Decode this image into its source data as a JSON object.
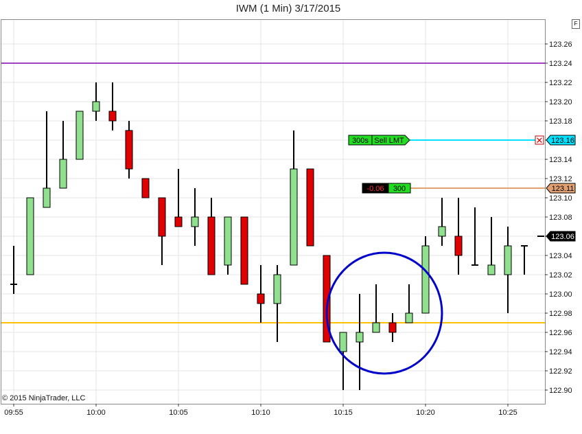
{
  "window": {
    "title": "IWM (1 Min)  3/17/2015",
    "corner_button": "F"
  },
  "copyright": "© 2015 NinjaTrader, LLC",
  "colors": {
    "up_candle": "#90e090",
    "down_candle": "#e00000",
    "candle_outline": "#000000",
    "grid": "#e4e4e4",
    "resistance_line": "#a040c0",
    "support_line": "#ffc000",
    "order_line": "#00e0ff",
    "position_line": "#e0a070",
    "circle": "#0000cc"
  },
  "chart_data": {
    "type": "candlestick",
    "x_tick_labels": [
      "09:55",
      "10:00",
      "10:05",
      "10:10",
      "10:15",
      "10:20",
      "10:25"
    ],
    "y_tick_labels": [
      "123.26",
      "123.24",
      "123.22",
      "123.20",
      "123.18",
      "123.16",
      "123.14",
      "123.12",
      "123.10",
      "123.08",
      "123.06",
      "123.04",
      "123.02",
      "123.00",
      "122.98",
      "122.96",
      "122.94",
      "122.92",
      "122.90"
    ],
    "ylim": [
      122.89,
      123.28
    ],
    "grid": true,
    "candles": [
      {
        "time": "09:55",
        "open": 123.01,
        "high": 123.05,
        "low": 123.0,
        "close": 123.01
      },
      {
        "time": "09:56",
        "open": 123.02,
        "high": 123.1,
        "low": 123.02,
        "close": 123.1
      },
      {
        "time": "09:57",
        "open": 123.09,
        "high": 123.19,
        "low": 123.09,
        "close": 123.11
      },
      {
        "time": "09:58",
        "open": 123.11,
        "high": 123.18,
        "low": 123.11,
        "close": 123.14
      },
      {
        "time": "09:59",
        "open": 123.14,
        "high": 123.19,
        "low": 123.14,
        "close": 123.19
      },
      {
        "time": "10:00",
        "open": 123.19,
        "high": 123.22,
        "low": 123.18,
        "close": 123.2
      },
      {
        "time": "10:01",
        "open": 123.19,
        "high": 123.22,
        "low": 123.17,
        "close": 123.18
      },
      {
        "time": "10:02",
        "open": 123.17,
        "high": 123.18,
        "low": 123.12,
        "close": 123.13
      },
      {
        "time": "10:03",
        "open": 123.12,
        "high": 123.12,
        "low": 123.1,
        "close": 123.1
      },
      {
        "time": "10:04",
        "open": 123.1,
        "high": 123.1,
        "low": 123.03,
        "close": 123.06
      },
      {
        "time": "10:05",
        "open": 123.08,
        "high": 123.13,
        "low": 123.07,
        "close": 123.07
      },
      {
        "time": "10:06",
        "open": 123.07,
        "high": 123.11,
        "low": 123.05,
        "close": 123.08
      },
      {
        "time": "10:07",
        "open": 123.08,
        "high": 123.1,
        "low": 123.02,
        "close": 123.02
      },
      {
        "time": "10:08",
        "open": 123.03,
        "high": 123.08,
        "low": 123.02,
        "close": 123.08
      },
      {
        "time": "10:09",
        "open": 123.08,
        "high": 123.08,
        "low": 123.01,
        "close": 123.01
      },
      {
        "time": "10:10",
        "open": 123.0,
        "high": 123.03,
        "low": 122.97,
        "close": 122.99
      },
      {
        "time": "10:11",
        "open": 122.99,
        "high": 123.03,
        "low": 122.95,
        "close": 123.02
      },
      {
        "time": "10:12",
        "open": 123.03,
        "high": 123.17,
        "low": 123.03,
        "close": 123.13
      },
      {
        "time": "10:13",
        "open": 123.13,
        "high": 123.13,
        "low": 123.05,
        "close": 123.05
      },
      {
        "time": "10:14",
        "open": 123.04,
        "high": 123.04,
        "low": 122.95,
        "close": 122.95
      },
      {
        "time": "10:15",
        "open": 122.94,
        "high": 122.96,
        "low": 122.9,
        "close": 122.96
      },
      {
        "time": "10:16",
        "open": 122.95,
        "high": 123.0,
        "low": 122.9,
        "close": 122.96
      },
      {
        "time": "10:17",
        "open": 122.96,
        "high": 123.01,
        "low": 122.96,
        "close": 122.97
      },
      {
        "time": "10:18",
        "open": 122.97,
        "high": 122.98,
        "low": 122.95,
        "close": 122.96
      },
      {
        "time": "10:19",
        "open": 122.97,
        "high": 123.01,
        "low": 122.97,
        "close": 122.98
      },
      {
        "time": "10:20",
        "open": 122.98,
        "high": 123.06,
        "low": 122.98,
        "close": 123.05
      },
      {
        "time": "10:21",
        "open": 123.06,
        "high": 123.1,
        "low": 123.05,
        "close": 123.07
      },
      {
        "time": "10:22",
        "open": 123.06,
        "high": 123.1,
        "low": 123.02,
        "close": 123.04
      },
      {
        "time": "10:23",
        "open": 123.03,
        "high": 123.09,
        "low": 123.03,
        "close": 123.03
      },
      {
        "time": "10:24",
        "open": 123.02,
        "high": 123.08,
        "low": 123.02,
        "close": 123.03
      },
      {
        "time": "10:25",
        "open": 123.02,
        "high": 123.07,
        "low": 122.98,
        "close": 123.05
      },
      {
        "time": "10:26",
        "open": 123.05,
        "high": 123.05,
        "low": 123.02,
        "close": 123.05
      },
      {
        "time": "10:27",
        "open": 123.06,
        "high": 123.06,
        "low": 123.06,
        "close": 123.06
      }
    ],
    "horizontal_lines": [
      {
        "name": "resistance",
        "price": 123.24
      },
      {
        "name": "support",
        "price": 122.97
      },
      {
        "name": "sell-limit-order",
        "price": 123.16
      },
      {
        "name": "position-average",
        "price": 123.11
      }
    ],
    "annotations": {
      "circle_center": {
        "time": "10:17.5",
        "price": 122.98
      },
      "order_tag": {
        "quantity": "300s",
        "label": "Sell LMT",
        "price_label": "123.16",
        "cancel_glyph": "✕"
      },
      "position_tag": {
        "pnl": "-0.06",
        "quantity": "300",
        "price_label": "123.11"
      },
      "last_price_label": "123.06"
    }
  }
}
